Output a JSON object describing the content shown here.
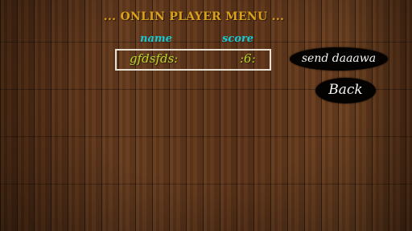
{
  "title": "... ONLIN PLAYER MENU ...",
  "table": {
    "headers": {
      "name": "name",
      "score": "score"
    },
    "rows": [
      {
        "name": "gfdsfds:",
        "score": ":6:"
      }
    ]
  },
  "buttons": {
    "send": "send daaawa",
    "back": "Back"
  },
  "colors": {
    "title": "#d9a21a",
    "header": "#19c6d2",
    "cell": "#b7d62a",
    "button_bg": "#050302",
    "button_text": "#f4f4f4",
    "box_border": "#e8e2d4"
  }
}
